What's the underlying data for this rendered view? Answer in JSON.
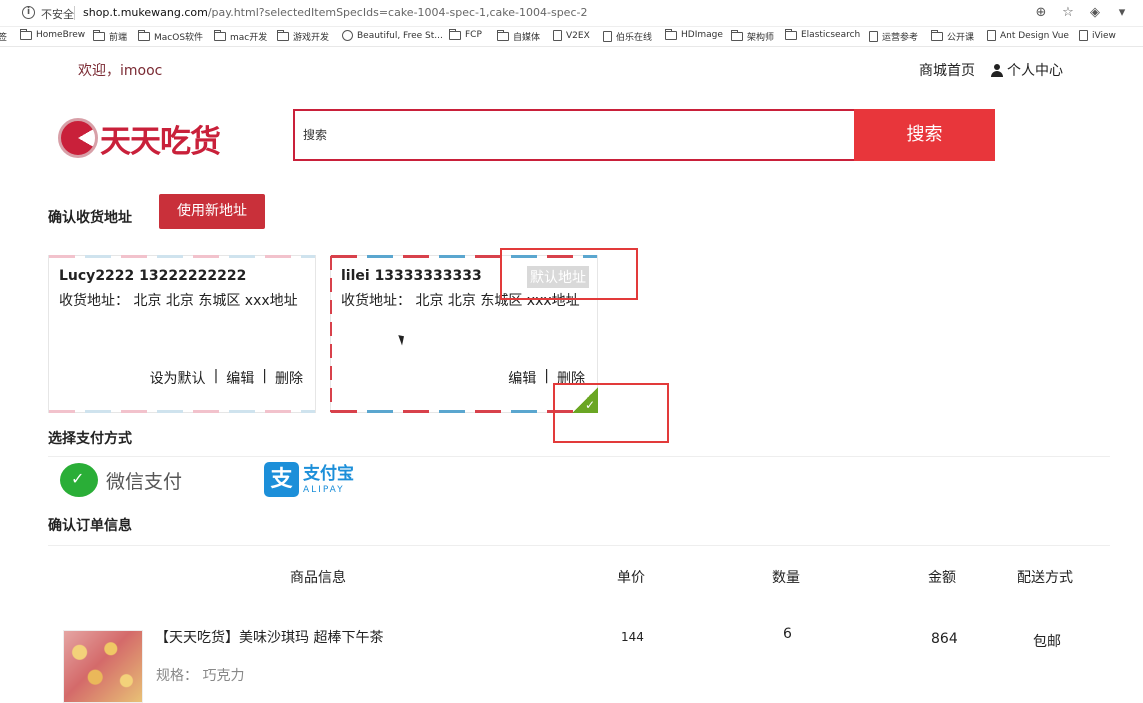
{
  "browser": {
    "security_label": "不安全",
    "url_host": "shop.t.mukewang.com",
    "url_path": "/pay.html?selectedItemSpecIds=cake-1004-spec-1,cake-1004-spec-2",
    "bookmarks": [
      "签",
      "HomeBrew",
      "前端",
      "MacOS软件",
      "mac开发",
      "游戏开发",
      "Beautiful, Free St...",
      "FCP",
      "自媒体",
      "V2EX",
      "伯乐在线",
      "HDImage",
      "架构师",
      "Elasticsearch",
      "运营参考",
      "公开课",
      "Ant Design Vue",
      "iView"
    ]
  },
  "header": {
    "welcome": "欢迎，imooc",
    "home_link": "商城首页",
    "user_center": "个人中心",
    "logo_text": "天天吃货"
  },
  "search": {
    "placeholder": "搜索",
    "button": "搜索"
  },
  "address": {
    "section_title": "确认收货地址",
    "new_button": "使用新地址",
    "cards": [
      {
        "name": "Lucy2222 13222222222",
        "address": "收货地址：  北京 北京 东城区 xxx地址",
        "set_default": "设为默认",
        "edit": "编辑",
        "delete": "删除",
        "divider": "|"
      },
      {
        "name": "lilei 13333333333",
        "address": "收货地址：  北京 北京 东城区 xxx地址",
        "badge": "默认地址",
        "edit": "编辑",
        "delete": "删除",
        "divider": "|"
      }
    ]
  },
  "payment": {
    "section_title": "选择支付方式",
    "wechat": "微信支付",
    "alipay_cn": "支付宝",
    "alipay_en": "ALIPAY",
    "alipay_mark": "支"
  },
  "order": {
    "section_title": "确认订单信息",
    "columns": [
      "商品信息",
      "单价",
      "数量",
      "金额",
      "配送方式"
    ],
    "items": [
      {
        "title": "【天天吃货】美味沙琪玛 超棒下午茶",
        "spec": "规格：  巧克力",
        "price": "144",
        "quantity": "6",
        "amount": "864",
        "shipping": "包邮"
      }
    ]
  },
  "colors": {
    "brand_red": "#c9203a",
    "search_button": "#e8363b",
    "annotation": "#e23a3a",
    "wechat_green": "#2aae37",
    "alipay_blue": "#1c8fd9"
  }
}
